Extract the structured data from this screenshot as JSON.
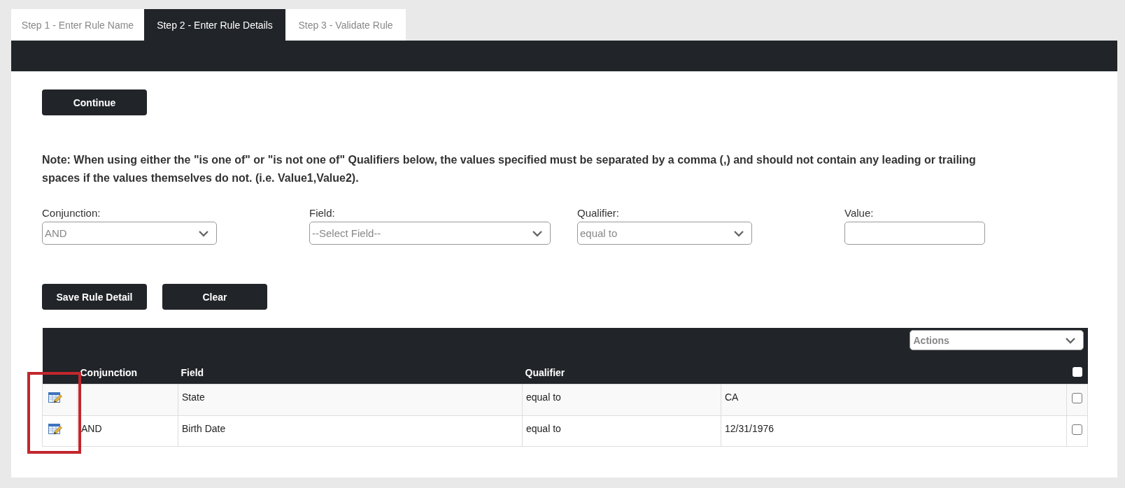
{
  "tabs": [
    {
      "label": "Step 1 - Enter Rule Name",
      "selected": false
    },
    {
      "label": "Step 2 - Enter Rule Details",
      "selected": true
    },
    {
      "label": "Step 3 - Validate Rule",
      "selected": false
    }
  ],
  "continue_button": "Continue",
  "note": "Note: When using either the \"is one of\" or \"is not one of\" Qualifiers below, the values specified must be separated by a comma (,) and should not contain any leading or trailing spaces if the values themselves do not. (i.e. Value1,Value2).",
  "filters": [
    {
      "kind": "select",
      "label": "Conjunction:",
      "value": "AND"
    },
    {
      "kind": "select",
      "label": "Field:",
      "value": "--Select Field--"
    },
    {
      "kind": "select",
      "label": "Qualifier:",
      "value": "equal to"
    },
    {
      "kind": "text",
      "label": "Value:"
    }
  ],
  "action_buttons": [
    "Save Rule Detail",
    "Clear"
  ],
  "table": {
    "actions_select": "Actions",
    "select_all_checked": false,
    "edit_column_highlighted": true,
    "columns": {
      "conjunction": "Conjunction",
      "field": "Field",
      "qualifier": "Qualifier"
    },
    "rows": [
      {
        "field": "State",
        "qualifier": "equal to",
        "column_5": "CA",
        "checked": false
      },
      {
        "conjunction": "AND",
        "field": "Birth Date",
        "qualifier": "equal to",
        "column_5": "12/31/1976",
        "checked": false
      }
    ]
  }
}
